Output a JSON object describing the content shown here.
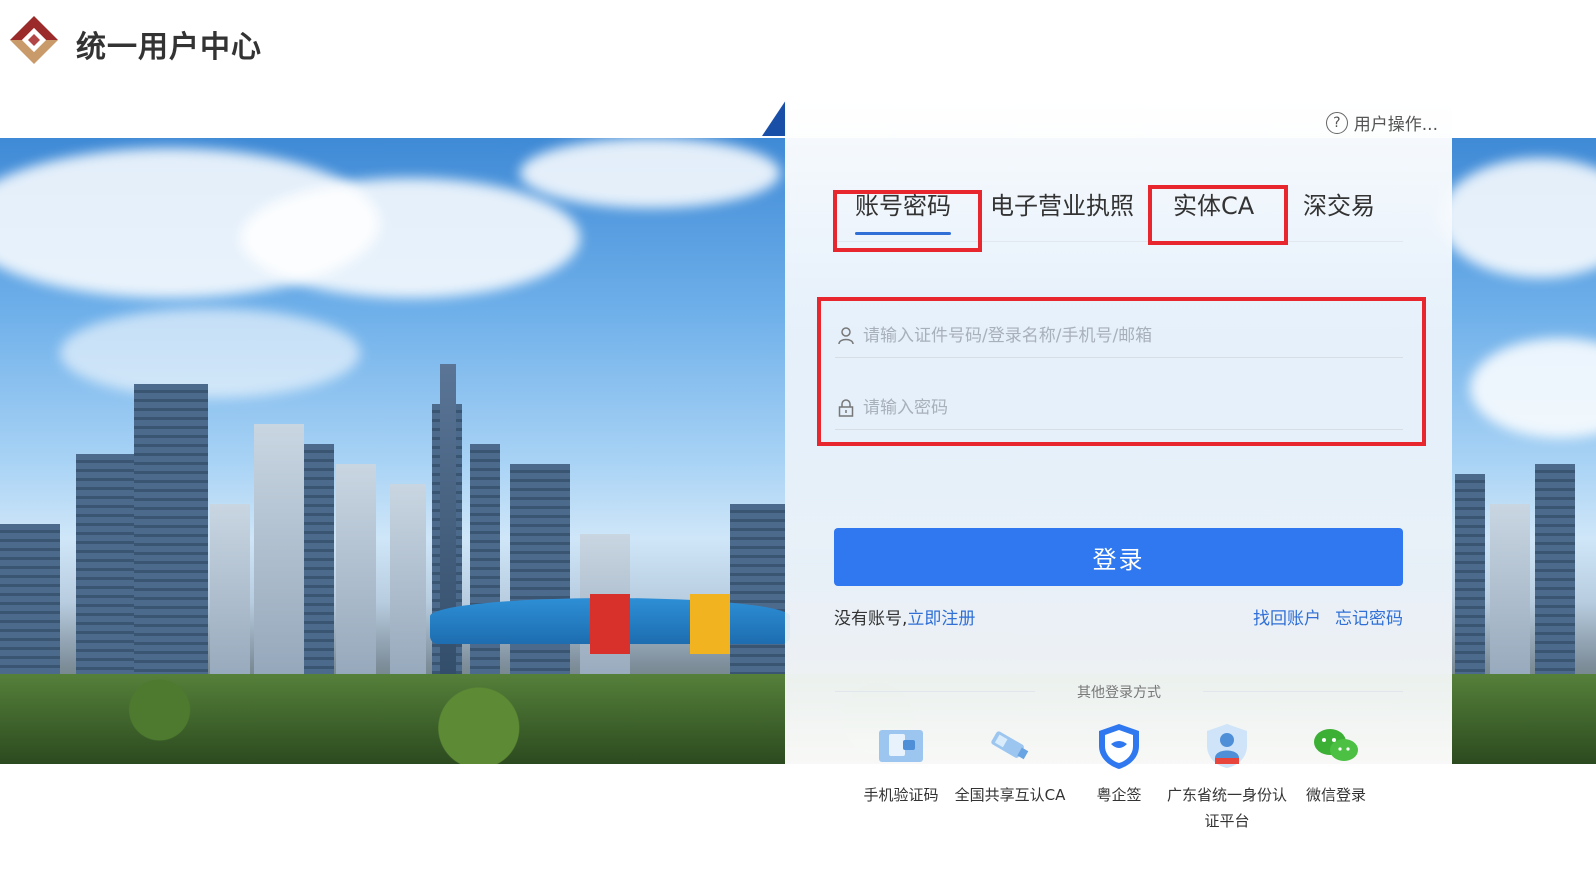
{
  "header": {
    "title": "统一用户中心"
  },
  "help": {
    "label": "用户操作..."
  },
  "tabs": [
    {
      "label": "账号密码",
      "active": true
    },
    {
      "label": "电子营业执照",
      "active": false
    },
    {
      "label": "实体CA",
      "active": false
    },
    {
      "label": "深交易",
      "active": false
    }
  ],
  "form": {
    "account_placeholder": "请输入证件号码/登录名称/手机号/邮箱",
    "password_placeholder": "请输入密码",
    "login_label": "登录"
  },
  "links": {
    "no_account": "没有账号,",
    "register": "立即注册",
    "find_account": "找回账户",
    "forgot_password": "忘记密码"
  },
  "other_login": {
    "title": "其他登录方式",
    "methods": [
      {
        "label": "手机验证码",
        "icon": "phone-sms-icon"
      },
      {
        "label": "全国共享互认CA",
        "icon": "usb-key-icon"
      },
      {
        "label": "粤企签",
        "icon": "shield-icon"
      },
      {
        "label": "广东省统一身份认证平台",
        "icon": "identity-icon"
      },
      {
        "label": "微信登录",
        "icon": "wechat-icon"
      }
    ]
  },
  "colors": {
    "primary": "#2f78f0",
    "link": "#2f6fd6",
    "highlight_box": "#e8262d",
    "logo_red": "#9b2a2a",
    "logo_tan": "#c99a6a"
  }
}
